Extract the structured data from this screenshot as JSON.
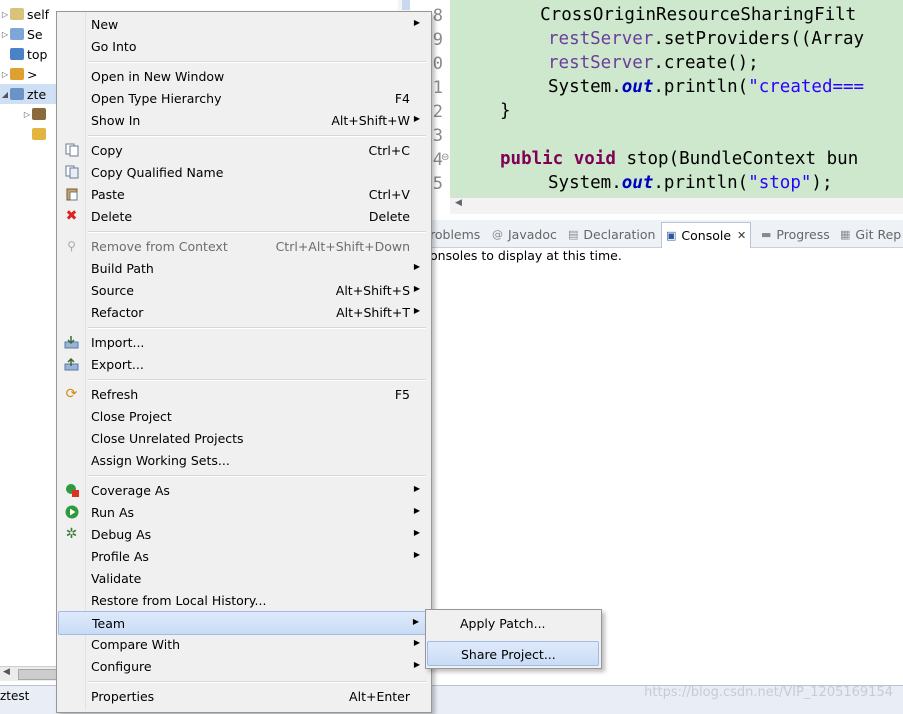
{
  "explorer": {
    "items": [
      {
        "label": "self",
        "expander": "▷"
      },
      {
        "label": "Se",
        "expander": "▷"
      },
      {
        "label": "top",
        "expander": ""
      },
      {
        "label": "> ",
        "expander": "▷"
      },
      {
        "label": "zte",
        "expander": "◢"
      },
      {
        "label": "",
        "expander": "▷"
      },
      {
        "label": "",
        "expander": ""
      }
    ],
    "status_text": "ztest"
  },
  "editor": {
    "line_numbers": [
      "8",
      "9",
      "0",
      "1",
      "2",
      "3",
      "4",
      "5"
    ],
    "code_lines": [
      {
        "text": "    CrossOriginResourceSharingFilt"
      },
      {
        "var": "restServer",
        "rest": ".setProviders((Array"
      },
      {
        "var": "restServer",
        "rest": ".create();"
      },
      {
        "pre": "System.",
        "field": "out",
        "mid": ".println(",
        "str": "\"created==="
      },
      {
        "text": "}"
      },
      {
        "text": ""
      },
      {
        "kw": "public void",
        "rest": " stop(BundleContext bun"
      },
      {
        "pre": "System.",
        "field": "out",
        "mid": ".println(",
        "str": "\"stop\"",
        "post": ");"
      }
    ]
  },
  "views": {
    "tabs": [
      {
        "label": "roblems",
        "icon": "⚠"
      },
      {
        "label": "Javadoc",
        "icon": "@"
      },
      {
        "label": "Declaration",
        "icon": "▤"
      },
      {
        "label": "Console",
        "icon": "▣",
        "close": "✕"
      },
      {
        "label": "Progress",
        "icon": "▬"
      },
      {
        "label": "Git Rep",
        "icon": "▦"
      }
    ],
    "console_message": "onsoles to display at this time."
  },
  "menu": {
    "items": [
      {
        "label": "New",
        "accel": "",
        "submenu": true,
        "icon": ""
      },
      {
        "label": "Go Into",
        "accel": "",
        "submenu": false,
        "icon": ""
      },
      {
        "label": "Open in New Window",
        "accel": "",
        "submenu": false,
        "icon": ""
      },
      {
        "label": "Open Type Hierarchy",
        "accel": "F4",
        "submenu": false,
        "icon": ""
      },
      {
        "label": "Show In",
        "accel": "Alt+Shift+W",
        "submenu": true,
        "icon": ""
      },
      {
        "label": "Copy",
        "accel": "Ctrl+C",
        "submenu": false,
        "icon": "copy-icon"
      },
      {
        "label": "Copy Qualified Name",
        "accel": "",
        "submenu": false,
        "icon": "copy-qualified-icon"
      },
      {
        "label": "Paste",
        "accel": "Ctrl+V",
        "submenu": false,
        "icon": "paste-icon"
      },
      {
        "label": "Delete",
        "accel": "Delete",
        "submenu": false,
        "icon": "delete-icon"
      },
      {
        "label": "Remove from Context",
        "accel": "Ctrl+Alt+Shift+Down",
        "submenu": false,
        "icon": "remove-context-icon",
        "disabled": true
      },
      {
        "label": "Build Path",
        "accel": "",
        "submenu": true,
        "icon": ""
      },
      {
        "label": "Source",
        "accel": "Alt+Shift+S",
        "submenu": true,
        "icon": ""
      },
      {
        "label": "Refactor",
        "accel": "Alt+Shift+T",
        "submenu": true,
        "icon": ""
      },
      {
        "label": "Import...",
        "accel": "",
        "submenu": false,
        "icon": "import-icon"
      },
      {
        "label": "Export...",
        "accel": "",
        "submenu": false,
        "icon": "export-icon"
      },
      {
        "label": "Refresh",
        "accel": "F5",
        "submenu": false,
        "icon": "refresh-icon"
      },
      {
        "label": "Close Project",
        "accel": "",
        "submenu": false,
        "icon": ""
      },
      {
        "label": "Close Unrelated Projects",
        "accel": "",
        "submenu": false,
        "icon": ""
      },
      {
        "label": "Assign Working Sets...",
        "accel": "",
        "submenu": false,
        "icon": ""
      },
      {
        "label": "Coverage As",
        "accel": "",
        "submenu": true,
        "icon": "coverage-icon"
      },
      {
        "label": "Run As",
        "accel": "",
        "submenu": true,
        "icon": "run-icon"
      },
      {
        "label": "Debug As",
        "accel": "",
        "submenu": true,
        "icon": "debug-icon"
      },
      {
        "label": "Profile As",
        "accel": "",
        "submenu": true,
        "icon": ""
      },
      {
        "label": "Validate",
        "accel": "",
        "submenu": false,
        "icon": ""
      },
      {
        "label": "Restore from Local History...",
        "accel": "",
        "submenu": false,
        "icon": ""
      },
      {
        "label": "Team",
        "accel": "",
        "submenu": true,
        "icon": "",
        "highlighted": true
      },
      {
        "label": "Compare With",
        "accel": "",
        "submenu": true,
        "icon": ""
      },
      {
        "label": "Configure",
        "accel": "",
        "submenu": true,
        "icon": ""
      },
      {
        "label": "Properties",
        "accel": "Alt+Enter",
        "submenu": false,
        "icon": ""
      }
    ]
  },
  "team_submenu": {
    "items": [
      {
        "label": "Apply Patch...",
        "highlighted": false
      },
      {
        "label": "Share Project...",
        "highlighted": true
      }
    ]
  },
  "watermark": "https://blog.csdn.net/VIP_1205169154",
  "colors": {
    "menu_bg": "#f0f0f0",
    "highlight_border": "#9fbce6",
    "code_bg": "#cde8cd",
    "keyword": "#7f0055",
    "string": "#2a00ff"
  }
}
